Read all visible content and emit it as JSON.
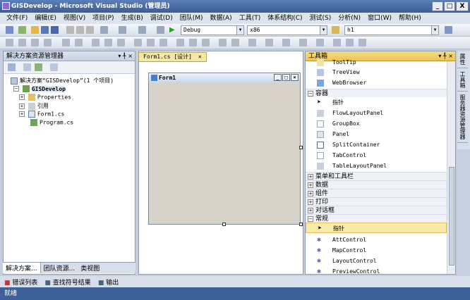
{
  "window": {
    "title": "GISDevelop - Microsoft Visual Studio (管理员)",
    "buttons": [
      "_",
      "□",
      "X"
    ]
  },
  "menu": [
    "文件(F)",
    "编辑(E)",
    "视图(V)",
    "项目(P)",
    "生成(B)",
    "调试(D)",
    "团队(M)",
    "数据(A)",
    "工具(T)",
    "体系结构(C)",
    "测试(S)",
    "分析(N)",
    "窗口(W)",
    "帮助(H)"
  ],
  "toolbar": {
    "config": "Debug",
    "platform": "x86",
    "find": "h1"
  },
  "solution_explorer": {
    "title": "解决方案资源管理器",
    "controls": "▾ ╀ ×",
    "tree": [
      {
        "label": "解决方案“GISDevelop”(1 个项目)",
        "indent": 0,
        "icon": "solution-icon"
      },
      {
        "label": "GISDevelop",
        "indent": 1,
        "icon": "project-icon"
      },
      {
        "label": "Properties",
        "indent": 2,
        "icon": "folder-icon"
      },
      {
        "label": "引用",
        "indent": 2,
        "icon": "references-icon"
      },
      {
        "label": "Form1.cs",
        "indent": 2,
        "icon": "form-icon"
      },
      {
        "label": "Program.cs",
        "indent": 3,
        "icon": "csharp-icon"
      }
    ],
    "tabs": [
      "解决方案...",
      "团队资源...",
      "类视图"
    ]
  },
  "designer": {
    "tab": "Form1.cs [设计]",
    "form_title": "Form1"
  },
  "toolbox": {
    "title": "工具箱",
    "controls": "▾ ╀ ×",
    "items_top": [
      {
        "label": "ToolTip",
        "icon": "tooltip-icon"
      },
      {
        "label": "TreeView",
        "icon": "treeview-icon"
      },
      {
        "label": "WebBrowser",
        "icon": "webbrowser-icon"
      }
    ],
    "containers_title": "容器",
    "containers": [
      {
        "label": "指针",
        "icon": "pointer-icon"
      },
      {
        "label": "FlowLayoutPanel",
        "icon": "flowlayout-icon"
      },
      {
        "label": "GroupBox",
        "icon": "groupbox-icon"
      },
      {
        "label": "Panel",
        "icon": "panel-icon"
      },
      {
        "label": "SplitContainer",
        "icon": "splitcontainer-icon"
      },
      {
        "label": "TabControl",
        "icon": "tabcontrol-icon"
      },
      {
        "label": "TableLayoutPanel",
        "icon": "tablelayout-icon"
      }
    ],
    "sections": [
      "菜单和工具栏",
      "数据",
      "组件",
      "打印",
      "对话框"
    ],
    "general_title": "常规",
    "general": [
      {
        "label": "指针",
        "icon": "pointer-icon"
      },
      {
        "label": "AttControl",
        "icon": "gear-icon"
      },
      {
        "label": "MapControl",
        "icon": "gear-icon"
      },
      {
        "label": "LayoutControl",
        "icon": "gear-icon"
      },
      {
        "label": "PreviewControl",
        "icon": "gear-icon"
      }
    ]
  },
  "side_tabs": [
    "属性",
    "工具箱",
    "服务器资源管理器"
  ],
  "bottom_tabs": [
    "错误列表",
    "查找符号结果",
    "输出"
  ],
  "status": "就绪",
  "colors": {
    "title_bar": "#3b5c95",
    "status_bar": "#3e6199",
    "toolbox_header": "#ecc45a",
    "selection": "#fbe9a8"
  }
}
